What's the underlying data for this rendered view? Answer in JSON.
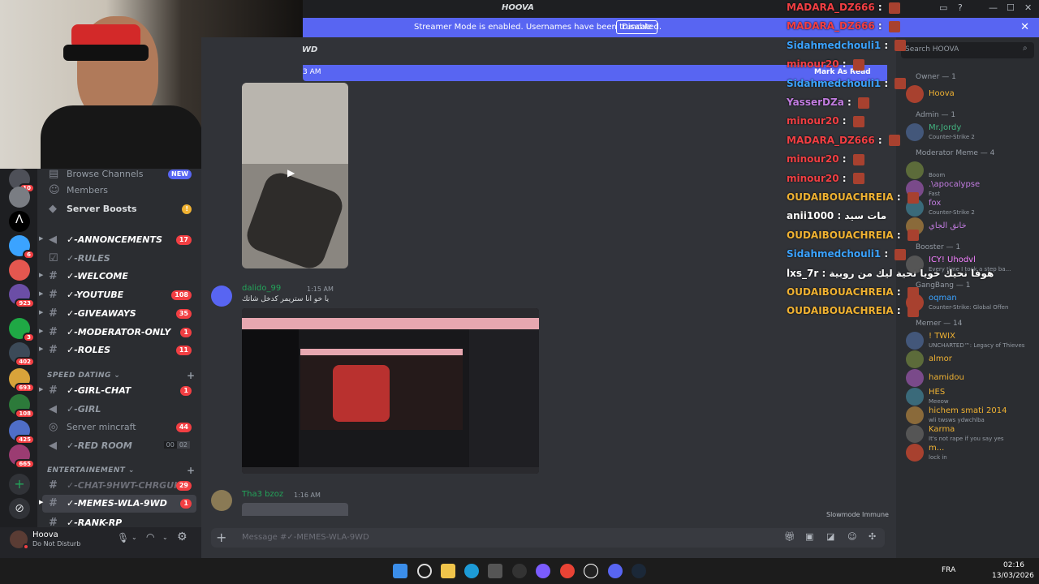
{
  "titlebar": {
    "title": "HOOVA"
  },
  "banner": {
    "text": "Streamer Mode is enabled. Usernames have been truncated.",
    "button": "Disable",
    "close": "✕"
  },
  "header": {
    "channel_fragment": "WD",
    "new_since": "3 AM",
    "mark_as_read": "Mark As Read"
  },
  "rail": {
    "badges": [
      "10",
      "6",
      "923",
      "3",
      "402",
      "693",
      "108",
      "425",
      "665"
    ]
  },
  "sidebar": {
    "top_items": [
      {
        "label": "Browse Channels",
        "tag": "NEW"
      },
      {
        "label": "Members"
      },
      {
        "label": "Server Boosts"
      }
    ],
    "channels": [
      {
        "label": "✓-ANNONCEMENTS",
        "count": "17"
      },
      {
        "label": "✓-RULES"
      },
      {
        "label": "✓-WELCOME"
      },
      {
        "label": "✓-YOUTUBE",
        "count": "108"
      },
      {
        "label": "✓-GIVEAWAYS",
        "count": "35"
      },
      {
        "label": "✓-MODERATOR-ONLY",
        "count": "1"
      },
      {
        "label": "✓-ROLES",
        "count": "11"
      }
    ],
    "category_speed": "SPEED DATING",
    "speed_channels": [
      {
        "label": "✓-GIRL-CHAT",
        "count": "1"
      },
      {
        "label": "✓-GIRL"
      },
      {
        "label": "Server mincraft",
        "count": "44"
      },
      {
        "label": "✓-RED ROOM",
        "voice": [
          "00",
          "02"
        ]
      }
    ],
    "category_ent": "ENTERTAINEMENT",
    "ent_channels": [
      {
        "label": "✓-CHAT-9HWT-CHRGUI",
        "count": "29"
      },
      {
        "label": "✓-MEMES-WLA-9WD",
        "count": "1"
      },
      {
        "label": "✓-RANK-RP"
      }
    ]
  },
  "user": {
    "name": "Hoova",
    "status": "Do Not Disturb"
  },
  "messages": [
    {
      "author": "dalido_99",
      "time": "1:15 AM",
      "text": "يا خو انا ستريمر كدخل شاتك"
    },
    {
      "author": "Tha3 bzoz",
      "time": "1:16 AM"
    }
  ],
  "composer": {
    "placeholder": "Message #✓-MEMES-WLA-9WD",
    "slowmode": "Slowmode Immune"
  },
  "members": {
    "search_placeholder": "Search HOOVA",
    "groups": [
      {
        "title": "Owner — 1",
        "items": [
          {
            "name": "Hoova",
            "status": "",
            "color": "#f0b232"
          }
        ]
      },
      {
        "title": "Admin — 1",
        "items": [
          {
            "name": "Mr.Jordy",
            "status": "Counter-Strike 2",
            "color": "#43b581"
          }
        ]
      },
      {
        "title": "Moderator Meme — 4",
        "items": [
          {
            "name": "",
            "status": "Boom",
            "color": "#dbdee1"
          },
          {
            "name": ".\\apocalypse",
            "status": "Fast",
            "color": "#c27ce0"
          },
          {
            "name": "fox",
            "status": "Counter-Strike 2",
            "color": "#c27ce0"
          },
          {
            "name": "خانق الجاي",
            "status": "",
            "color": "#c27ce0"
          }
        ]
      },
      {
        "title": "Booster — 1",
        "items": [
          {
            "name": "ICY! Uhodvl",
            "status": "Every time I took a step ba...",
            "color": "#f47fff"
          }
        ]
      },
      {
        "title": "GangBang — 1",
        "items": [
          {
            "name": "oqman",
            "status": "Counter-Strike: Global Offen",
            "color": "#3ba3ff"
          }
        ]
      },
      {
        "title": "Memer — 14",
        "items": [
          {
            "name": "! TWIX",
            "status": "UNCHARTED™: Legacy of Thieves",
            "color": "#f0b232"
          },
          {
            "name": "almor",
            "status": "",
            "color": "#f0b232"
          },
          {
            "name": "hamidou",
            "status": "",
            "color": "#f0b232"
          },
          {
            "name": "HES",
            "status": "Meeow",
            "color": "#f0b232"
          },
          {
            "name": "hichem smati 2014",
            "status": "wli twsws ydwchlba",
            "color": "#f0b232"
          },
          {
            "name": "Karma",
            "status": "It's not rape if you say yes",
            "color": "#f0b232"
          },
          {
            "name": "m...",
            "status": "lock in",
            "color": "#f0b232"
          }
        ]
      }
    ]
  },
  "overlay_chat": [
    {
      "name": "MADARA_DZ666",
      "color": "#f23f43"
    },
    {
      "name": "MADARA_DZ666",
      "color": "#f23f43"
    },
    {
      "name": "Sidahmedchouli1",
      "color": "#3ba3ff"
    },
    {
      "name": "minour20",
      "color": "#f23f43"
    },
    {
      "name": "Sidahmedchouli1",
      "color": "#3ba3ff"
    },
    {
      "name": "YasserDZa",
      "color": "#c27ce0"
    },
    {
      "name": "minour20",
      "color": "#f23f43"
    },
    {
      "name": "MADARA_DZ666",
      "color": "#f23f43"
    },
    {
      "name": "minour20",
      "color": "#f23f43"
    },
    {
      "name": "minour20",
      "color": "#f23f43"
    },
    {
      "name": "OUDAIBOUACHREIA",
      "color": "#f0b232"
    },
    {
      "name": "anii1000",
      "color": "#ffffff",
      "msg": "مات سيد"
    },
    {
      "name": "OUDAIBOUACHREIA",
      "color": "#f0b232"
    },
    {
      "name": "Sidahmedchouli1",
      "color": "#3ba3ff"
    },
    {
      "name": "lxs_7r",
      "color": "#ffffff",
      "msg": "هوفا نحيك خويا نحية ليك من روبية"
    },
    {
      "name": "OUDAIBOUACHREIA",
      "color": "#f0b232"
    },
    {
      "name": "OUDAIBOUACHREIA",
      "color": "#f0b232"
    }
  ],
  "taskbar": {
    "lang": "FRA",
    "time": "02:16",
    "date": "13/03/2026"
  }
}
